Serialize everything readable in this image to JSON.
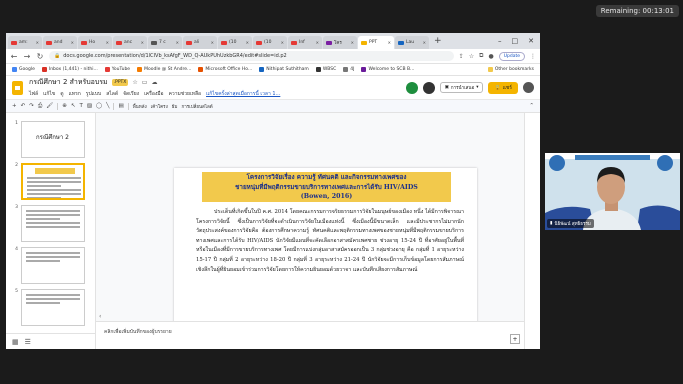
{
  "meeting": {
    "remaining": "Remaining: 00:13:01"
  },
  "browser": {
    "tabs": [
      {
        "label": "am:",
        "color": "#e53935"
      },
      {
        "label": "and",
        "color": "#e53935"
      },
      {
        "label": "Ho",
        "color": "#e53935"
      },
      {
        "label": "anc",
        "color": "#e53935"
      },
      {
        "label": "7 c",
        "color": "#555555"
      },
      {
        "label": "ali",
        "color": "#e53935"
      },
      {
        "label": "(10",
        "color": "#e53935"
      },
      {
        "label": "(10",
        "color": "#e53935"
      },
      {
        "label": "Inf",
        "color": "#e53935"
      },
      {
        "label": "โคร",
        "color": "#7b1fa2"
      },
      {
        "label": "PPT",
        "color": "#f4b400",
        "active": true
      },
      {
        "label": "Lau",
        "color": "#1565c0"
      }
    ],
    "new_tab": "+",
    "url": "docs.google.com/presentation/d/1lCIVb_ksAfgF_WD_Q-AUkPUhUzkbGR4/edit#slide=id.p2",
    "update_label": "Update",
    "bookmarks": [
      {
        "label": "Google",
        "color": "#4285f4"
      },
      {
        "label": "Inbox (1,441) - nithi...",
        "color": "#d93025"
      },
      {
        "label": "YouTube",
        "color": "#e53935"
      },
      {
        "label": "Moodle @ St Andre...",
        "color": "#f57c00"
      },
      {
        "label": "Microsoft Office Ho...",
        "color": "#e65100"
      },
      {
        "label": "Nithipat Suthitham",
        "color": "#1565c0"
      },
      {
        "label": "WBSC",
        "color": "#333333"
      },
      {
        "label": "4J",
        "color": "#777777"
      },
      {
        "label": "Welcome to SCB B...",
        "color": "#6a1b9a"
      }
    ],
    "other_bookmarks": "Other bookmarks"
  },
  "slides": {
    "doc_title": "กรณีศึกษา 2 สำหรับอบรม",
    "format_badge": ".PPTX",
    "menu": [
      "ไฟล์",
      "แก้ไข",
      "ดู",
      "แทรก",
      "รูปแบบ",
      "สไลด์",
      "จัดเรียง",
      "เครื่องมือ",
      "ความช่วยเหลือ"
    ],
    "last_edit": "แก้ไขครั้งล่าสุดเมื่อการนี้ เวลา 1...",
    "present_label": "การนำเสนอ",
    "share_label": "แชร์",
    "toolbar": {
      "background": "พื้นหลัง",
      "layout": "เค้าโครง",
      "theme": "ธีม",
      "transition": "การเปลี่ยนสไลด์"
    },
    "thumbnails": [
      {
        "num": "1",
        "text": "กรณีศึกษา 2"
      },
      {
        "num": "2",
        "text": ""
      },
      {
        "num": "3",
        "text": ""
      },
      {
        "num": "4",
        "text": ""
      },
      {
        "num": "5",
        "text": ""
      }
    ],
    "current_slide": {
      "title": "โครงการวิจัยเรื่อง ความรู้ ทัศนคติ และกิจกรรมทางเพศของชายหนุ่มที่มีพฤติกรรมขายบริการทางเพศในนิวซีแลนด์ ชายขายบริการทางเพศ: ความยินยอมที่ได้รับ HIV/AIDS (Bowen, 2016)",
      "title_lines": [
        "โครงการวิจัยเรื่อง ความรู้ ทัศนคติ และกิจกรรมทางเพศของ",
        "ชายหนุ่มที่มีพฤติกรรมขายบริการทางเพศและการได้รับ HIV/AIDS",
        "(Bowen, 2016)"
      ],
      "body": "ประเด็นที่เกิดขึ้นในปี ค.ศ. 2014 โดยคณะกรรมการจริยธรรมการวิจัยในมนุษย์ของเมือง หนึ่ง ได้มีการพิจารณาโครงการวิจัยนี้ ซึ่งเป็นการวิจัยที่จะดำเนินการวิจัยในเมืองแห่งนี้ ซึ่งเมืองนี้มีขนาดเล็ก และมีประชากรไม่มากนัก วัตถุประสงค์ของการวิจัยคือ ต้องการศึกษาความรู้ ทัศนคติและพฤติกรรมทางเพศของชายหนุ่มที่มีพฤติกรรมขายบริการทางเพศและการได้รับ HIV/AIDS นักวิจัยมีแผนที่จะคัดเลือกอาสาสมัครเพศชาย ช่วงอายุ 15-24 ปี ที่อาศัยอยู่ในพื้นที่หรือในเมืองที่มีการขายบริการทางเพศ โดยมีการแบ่งกลุ่มอาสาสมัครออกเป็น 3 กลุ่มช่วงอายุ คือ กลุ่มที่ 1 อายุระหว่าง 15-17 ปี กลุ่มที่ 2 อายุระหว่าง 18-20 ปี กลุ่มที่ 3 อายุระหว่าง 21-24 ปี นักวิจัยจะมีการเก็บข้อมูลโดยการสัมภาษณ์เชิงลึกในผู้ที่ยินยอมเข้าร่วมการวิจัยโดยการให้ความยินยอมด้วยวาจา และบันทึกเสียงการสัมภาษณ์",
      "page_number": "2"
    },
    "notes_placeholder": "คลิกเพื่อเพิ่มบันทึกของผู้บรรยาย"
  },
  "video": {
    "participant_name": "นิธิพัฒน์ สุทธิธรรม"
  }
}
